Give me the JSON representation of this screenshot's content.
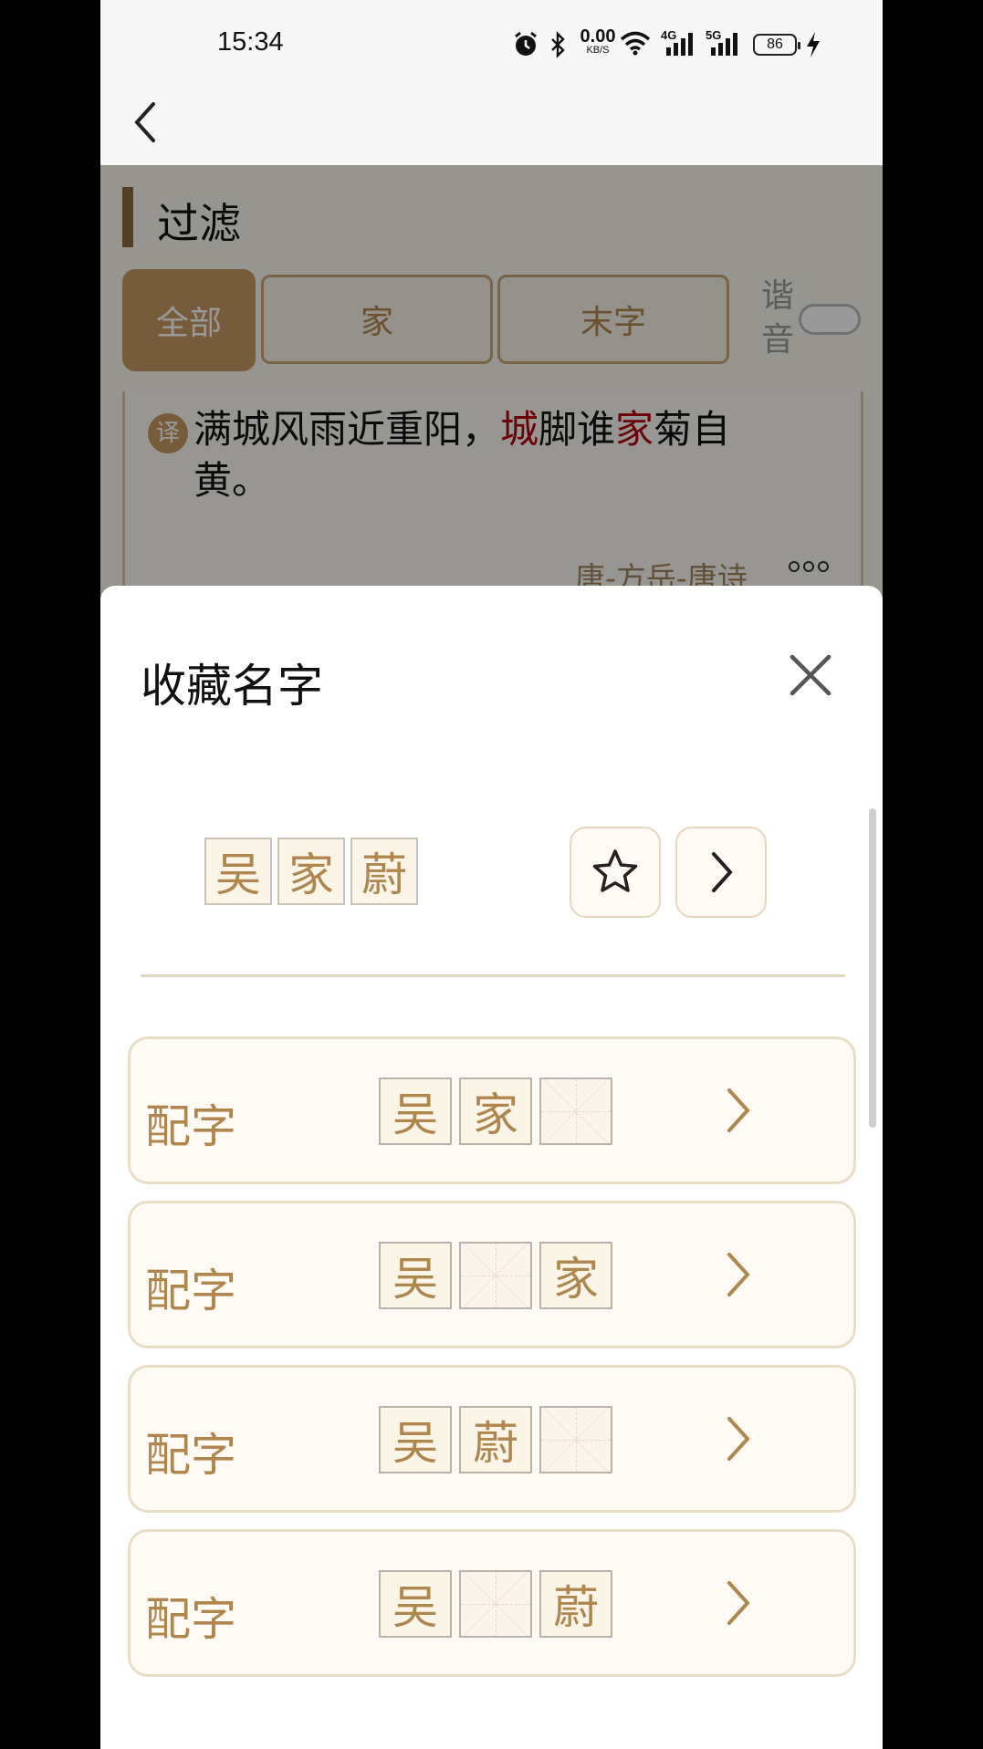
{
  "status_bar": {
    "time": "15:34",
    "net_speed_value": "0.00",
    "net_speed_unit": "KB/S",
    "signal_1_label": "4G",
    "signal_2_label": "5G",
    "battery": "86"
  },
  "background_page": {
    "filter_title": "过滤",
    "filters": [
      "全部",
      "家",
      "末字"
    ],
    "homophone_label": "谐音",
    "verse_badge": "译",
    "verse_parts": [
      "满城风雨近重阳，",
      "城",
      "脚谁",
      "家",
      "菊自黄。"
    ],
    "source": "唐-方岳-唐诗"
  },
  "sheet": {
    "title": "收藏名字",
    "name_chars": [
      "吴",
      "家",
      "蔚"
    ],
    "combos": [
      {
        "label": "配字",
        "chars": [
          "吴",
          "家",
          ""
        ]
      },
      {
        "label": "配字",
        "chars": [
          "吴",
          "",
          "家"
        ]
      },
      {
        "label": "配字",
        "chars": [
          "吴",
          "蔚",
          ""
        ]
      },
      {
        "label": "配字",
        "chars": [
          "吴",
          "",
          "蔚"
        ]
      }
    ]
  },
  "colors": {
    "accent": "#b0864f",
    "accent_fill": "#c79a63",
    "highlight": "#b4000e"
  }
}
